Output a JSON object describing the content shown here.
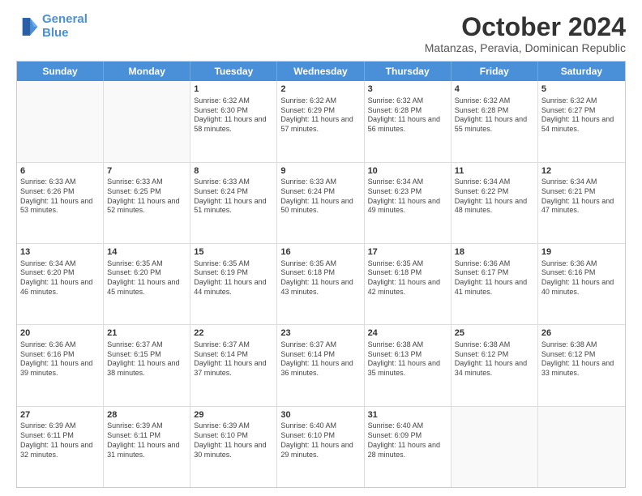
{
  "logo": {
    "line1": "General",
    "line2": "Blue"
  },
  "title": "October 2024",
  "subtitle": "Matanzas, Peravia, Dominican Republic",
  "header_days": [
    "Sunday",
    "Monday",
    "Tuesday",
    "Wednesday",
    "Thursday",
    "Friday",
    "Saturday"
  ],
  "rows": [
    [
      {
        "day": "",
        "info": ""
      },
      {
        "day": "",
        "info": ""
      },
      {
        "day": "1",
        "info": "Sunrise: 6:32 AM\nSunset: 6:30 PM\nDaylight: 11 hours and 58 minutes."
      },
      {
        "day": "2",
        "info": "Sunrise: 6:32 AM\nSunset: 6:29 PM\nDaylight: 11 hours and 57 minutes."
      },
      {
        "day": "3",
        "info": "Sunrise: 6:32 AM\nSunset: 6:28 PM\nDaylight: 11 hours and 56 minutes."
      },
      {
        "day": "4",
        "info": "Sunrise: 6:32 AM\nSunset: 6:28 PM\nDaylight: 11 hours and 55 minutes."
      },
      {
        "day": "5",
        "info": "Sunrise: 6:32 AM\nSunset: 6:27 PM\nDaylight: 11 hours and 54 minutes."
      }
    ],
    [
      {
        "day": "6",
        "info": "Sunrise: 6:33 AM\nSunset: 6:26 PM\nDaylight: 11 hours and 53 minutes."
      },
      {
        "day": "7",
        "info": "Sunrise: 6:33 AM\nSunset: 6:25 PM\nDaylight: 11 hours and 52 minutes."
      },
      {
        "day": "8",
        "info": "Sunrise: 6:33 AM\nSunset: 6:24 PM\nDaylight: 11 hours and 51 minutes."
      },
      {
        "day": "9",
        "info": "Sunrise: 6:33 AM\nSunset: 6:24 PM\nDaylight: 11 hours and 50 minutes."
      },
      {
        "day": "10",
        "info": "Sunrise: 6:34 AM\nSunset: 6:23 PM\nDaylight: 11 hours and 49 minutes."
      },
      {
        "day": "11",
        "info": "Sunrise: 6:34 AM\nSunset: 6:22 PM\nDaylight: 11 hours and 48 minutes."
      },
      {
        "day": "12",
        "info": "Sunrise: 6:34 AM\nSunset: 6:21 PM\nDaylight: 11 hours and 47 minutes."
      }
    ],
    [
      {
        "day": "13",
        "info": "Sunrise: 6:34 AM\nSunset: 6:20 PM\nDaylight: 11 hours and 46 minutes."
      },
      {
        "day": "14",
        "info": "Sunrise: 6:35 AM\nSunset: 6:20 PM\nDaylight: 11 hours and 45 minutes."
      },
      {
        "day": "15",
        "info": "Sunrise: 6:35 AM\nSunset: 6:19 PM\nDaylight: 11 hours and 44 minutes."
      },
      {
        "day": "16",
        "info": "Sunrise: 6:35 AM\nSunset: 6:18 PM\nDaylight: 11 hours and 43 minutes."
      },
      {
        "day": "17",
        "info": "Sunrise: 6:35 AM\nSunset: 6:18 PM\nDaylight: 11 hours and 42 minutes."
      },
      {
        "day": "18",
        "info": "Sunrise: 6:36 AM\nSunset: 6:17 PM\nDaylight: 11 hours and 41 minutes."
      },
      {
        "day": "19",
        "info": "Sunrise: 6:36 AM\nSunset: 6:16 PM\nDaylight: 11 hours and 40 minutes."
      }
    ],
    [
      {
        "day": "20",
        "info": "Sunrise: 6:36 AM\nSunset: 6:16 PM\nDaylight: 11 hours and 39 minutes."
      },
      {
        "day": "21",
        "info": "Sunrise: 6:37 AM\nSunset: 6:15 PM\nDaylight: 11 hours and 38 minutes."
      },
      {
        "day": "22",
        "info": "Sunrise: 6:37 AM\nSunset: 6:14 PM\nDaylight: 11 hours and 37 minutes."
      },
      {
        "day": "23",
        "info": "Sunrise: 6:37 AM\nSunset: 6:14 PM\nDaylight: 11 hours and 36 minutes."
      },
      {
        "day": "24",
        "info": "Sunrise: 6:38 AM\nSunset: 6:13 PM\nDaylight: 11 hours and 35 minutes."
      },
      {
        "day": "25",
        "info": "Sunrise: 6:38 AM\nSunset: 6:12 PM\nDaylight: 11 hours and 34 minutes."
      },
      {
        "day": "26",
        "info": "Sunrise: 6:38 AM\nSunset: 6:12 PM\nDaylight: 11 hours and 33 minutes."
      }
    ],
    [
      {
        "day": "27",
        "info": "Sunrise: 6:39 AM\nSunset: 6:11 PM\nDaylight: 11 hours and 32 minutes."
      },
      {
        "day": "28",
        "info": "Sunrise: 6:39 AM\nSunset: 6:11 PM\nDaylight: 11 hours and 31 minutes."
      },
      {
        "day": "29",
        "info": "Sunrise: 6:39 AM\nSunset: 6:10 PM\nDaylight: 11 hours and 30 minutes."
      },
      {
        "day": "30",
        "info": "Sunrise: 6:40 AM\nSunset: 6:10 PM\nDaylight: 11 hours and 29 minutes."
      },
      {
        "day": "31",
        "info": "Sunrise: 6:40 AM\nSunset: 6:09 PM\nDaylight: 11 hours and 28 minutes."
      },
      {
        "day": "",
        "info": ""
      },
      {
        "day": "",
        "info": ""
      }
    ]
  ]
}
